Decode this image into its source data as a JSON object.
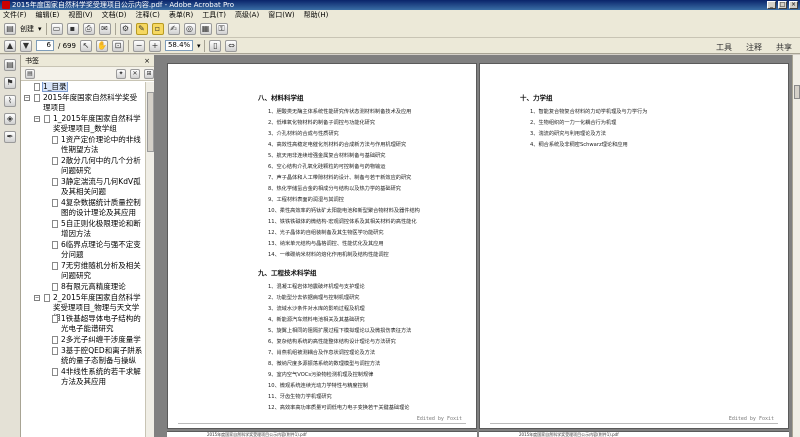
{
  "window": {
    "title": "2015年度国家自然科学奖受理项目公示内容.pdf - Adobe Acrobat Pro"
  },
  "menu": [
    "文件(F)",
    "编辑(E)",
    "视图(V)",
    "文档(D)",
    "注释(C)",
    "表单(R)",
    "工具(T)",
    "高级(A)",
    "窗口(W)",
    "帮助(H)"
  ],
  "toolbar": {
    "create_label": "创建",
    "page_current": "6",
    "page_total": "/ 699",
    "zoom": "58.4%"
  },
  "right_tools": {
    "tools": "工具",
    "comment": "注释",
    "share": "共享"
  },
  "bookmarks_panel": {
    "title": "书签",
    "items": [
      {
        "label": "1_目录"
      },
      {
        "label": "2015年度国家自然科学奖受理项目"
      },
      {
        "label": "1_2015年度国家自然科学奖受理项目_数学组"
      },
      {
        "label": "1资产定价理论中的非线性期望方法"
      },
      {
        "label": "2散分几何中的几个分析问题研究"
      },
      {
        "label": "3静定湍流与几何KdV孤及其相关问题"
      },
      {
        "label": "4复杂数据统计质量控制图的设计理论及其应用"
      },
      {
        "label": "5自正则化极限理论和断增因方法"
      },
      {
        "label": "6临界点理论与强不定变分问题"
      },
      {
        "label": "7无穷维随机分析及相关问题研究"
      },
      {
        "label": "8有限元高精度理论"
      },
      {
        "label": "2_2015年度国家自然科学奖受理项目_物理与天文学组"
      },
      {
        "label": "1铁基超导体电子结构的光电子能谱研究"
      },
      {
        "label": "2多光子纠缠干涉度量学"
      },
      {
        "label": "3基于腔QED和离子阱系统的量子态制备与操纵"
      },
      {
        "label": "4非线性系统的若干求解方法及其应用"
      }
    ]
  },
  "left_page": {
    "sections": [
      {
        "title": "八、材料科学组",
        "entries": [
          "1、胆酸类无酶主体系统性能研究传状态测材料制备技术及应用",
          "2、低维氧化物材料的制备子调控与功能化研究",
          "3、介孔材料的合成与性质研究",
          "4、高效性高稳定电催化剂材料的合成新方法与作用机理研究",
          "5、航天用非连续增强金属复合材料制备与基础研究",
          "6、空心结构介孔氧化硅颗粒的可控制备与药物输运",
          "7、声子晶体和人工带隙材料的设计、制备与若干新效应的研究",
          "8、热化学储氢合金的相成分与结构以及热力学的基础研究",
          "9、工程材料表面的润湿与其调控",
          "10、柔性高效率的钙钛矿太阳能电池和新型聚合物材料及器件结构",
          "11、铁铁铁磁体的微结构-宏观调控体系及其相关材料的高性能化",
          "12、光子晶体的自组装制备及其生物医学功能研究",
          "13、纳米单元结构与晶格调控、性能优化及其应用",
          "14、一维碳纳米材料的熔化作用机制及结构性能调控"
        ]
      },
      {
        "title": "九、工程技术科学组",
        "entries": [
          "1、混凝工程岩体地震破坏机理与支护理论",
          "2、功能型分去依据病理与控制机理研究",
          "3、流域水沙条件对水库的影响过程及机理",
          "4、新能源汽车燃料电池相关及其基础研究",
          "5、旋翼上相同的阻隔扩展过程下模拟理论以及微损伤表征方法",
          "6、复杂结构系统的高性能整体结构设计理论与方法研究",
          "7、肖燕机组被测耦合及作息状调控理论及方法",
          "8、微纳尺度多源振荡系统的数理模型与调控方法",
          "9、室内空气VOCs污染物检测机理及控制规律",
          "10、微观系统连续光动力学特性与精度控制",
          "11、牙齿生物力学机理研究",
          "12、高效率高功率质量可调低电力电子变换若干关键基础理论"
        ]
      }
    ],
    "watermark": "Edited by Foxit"
  },
  "right_page": {
    "sections": [
      {
        "title": "十、力学组",
        "entries": [
          "1、智能复合物复合材料的力动学机理及与力学行为",
          "2、生物组织的一力一化耦合行为机理",
          "3、湍流的研究与利用理论及方法",
          "4、稠合系统及非稠密Schwarz理论和应用"
        ]
      }
    ],
    "watermark": "Edited by Foxit"
  },
  "footer": {
    "left": "2015年度国家自然科学奖受理项目公示内容(附件1).pdf",
    "right": "2015年度国家自然科学奖受理项目公示内容(附件1).pdf"
  }
}
